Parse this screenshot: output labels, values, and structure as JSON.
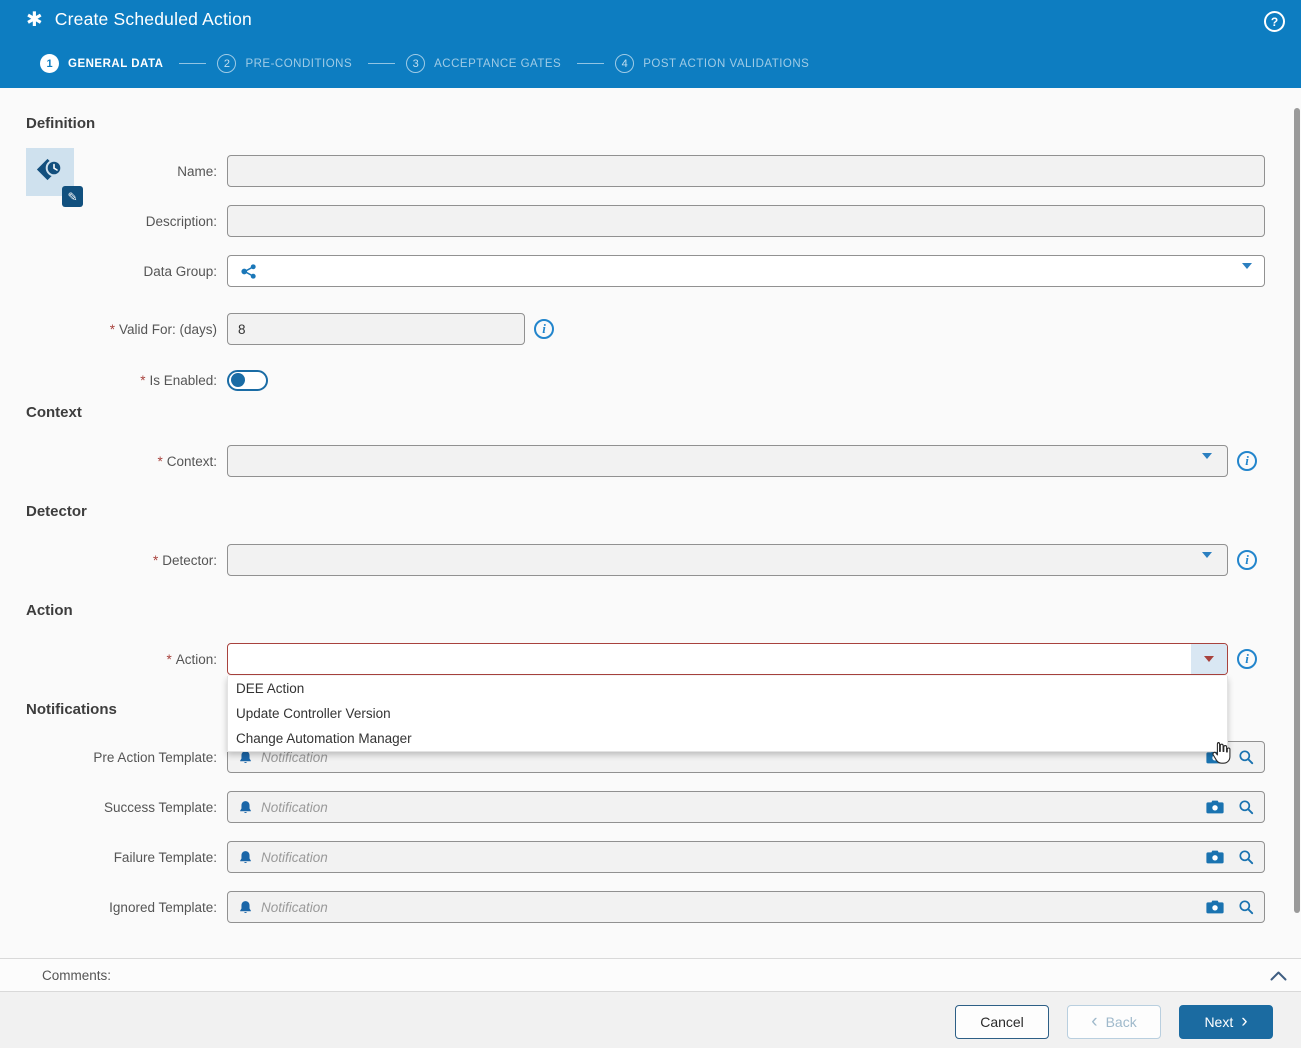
{
  "app": {
    "title": "Create Scheduled Action"
  },
  "icons": {
    "app_glyph": "✱",
    "help_glyph": "?",
    "info_glyph": "i",
    "pencil_glyph": "✎",
    "required_marker": "*"
  },
  "wizard": {
    "steps": [
      {
        "number": "1",
        "label": "GENERAL DATA",
        "state": "active"
      },
      {
        "number": "2",
        "label": "PRE-CONDITIONS",
        "state": "upcoming"
      },
      {
        "number": "3",
        "label": "ACCEPTANCE GATES",
        "state": "upcoming"
      },
      {
        "number": "4",
        "label": "POST ACTION VALIDATIONS",
        "state": "upcoming"
      }
    ]
  },
  "definition": {
    "heading": "Definition",
    "name_label": "Name:",
    "name_value": "",
    "description_label": "Description:",
    "description_value": "",
    "data_group_label": "Data Group:",
    "data_group_value": "",
    "valid_for_label": "Valid For: (days)",
    "valid_for_value": "8",
    "is_enabled_label": "Is Enabled:",
    "is_enabled_state": "off"
  },
  "context": {
    "heading": "Context",
    "label": "Context:",
    "value": ""
  },
  "detector": {
    "heading": "Detector",
    "label": "Detector:",
    "value": ""
  },
  "action": {
    "heading": "Action",
    "label": "Action:",
    "value": "",
    "options": [
      "DEE Action",
      "Update Controller Version",
      "Change Automation Manager"
    ]
  },
  "notifications": {
    "heading": "Notifications",
    "fields": [
      {
        "label": "Pre Action Template:",
        "placeholder": "Notification"
      },
      {
        "label": "Success Template:",
        "placeholder": "Notification"
      },
      {
        "label": "Failure Template:",
        "placeholder": "Notification"
      },
      {
        "label": "Ignored Template:",
        "placeholder": "Notification"
      }
    ]
  },
  "comments": {
    "label": "Comments:"
  },
  "footer": {
    "cancel_label": "Cancel",
    "back_label": "Back",
    "next_label": "Next",
    "back_chevron": "‹",
    "next_chevron": "›"
  },
  "colors": {
    "header_blue": "#0d7dc1",
    "accent_blue": "#1a6ca5",
    "info_blue": "#2285cc",
    "error_red": "#a8423d"
  }
}
